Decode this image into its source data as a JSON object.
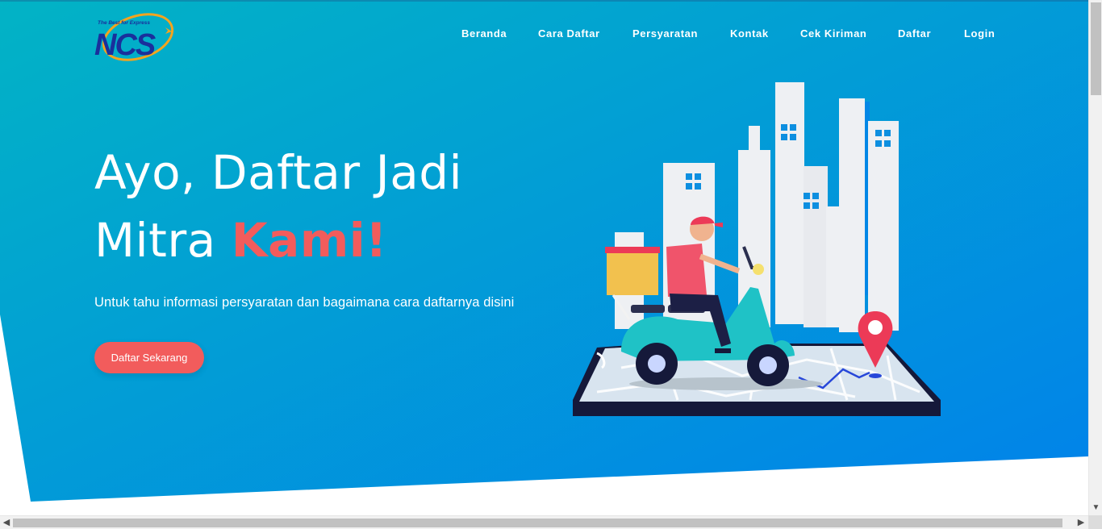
{
  "brand": {
    "logo_text": "NCS",
    "tagline": "The Best for Express"
  },
  "nav": {
    "items": [
      "Beranda",
      "Cara Daftar",
      "Persyaratan",
      "Kontak",
      "Cek Kiriman",
      "Daftar",
      "Login"
    ]
  },
  "hero": {
    "headline_line1": "Ayo, Daftar Jadi",
    "headline_line2_prefix": "Mitra ",
    "headline_line2_accent": "Kami!",
    "subtitle": "Untuk tahu informasi persyaratan dan bagaimana cara daftarnya disini",
    "cta_label": "Daftar Sekarang"
  },
  "colors": {
    "gradient_start": "#02b1c7",
    "gradient_end": "#0287e6",
    "accent": "#f25c5c",
    "logo_blue": "#1a2f9c",
    "logo_orange": "#f4a41e"
  },
  "icons": {
    "scroll_left": "chevron-left-icon",
    "scroll_right": "chevron-right-icon",
    "scroll_down": "chevron-down-icon"
  }
}
